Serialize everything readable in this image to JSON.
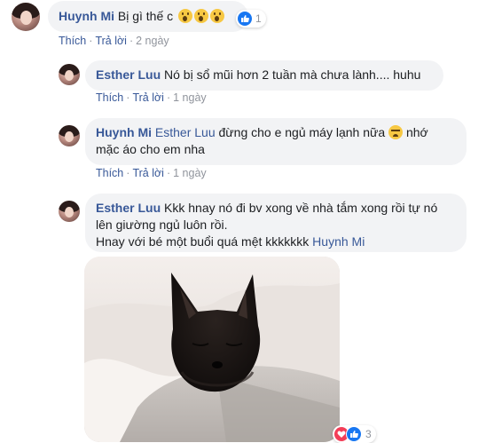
{
  "comment1": {
    "author": "Huynh Mi",
    "text": "Bị gì thế c",
    "reaction_count": "1",
    "like_label": "Thích",
    "reply_label": "Trả lời",
    "time": "2 ngày",
    "separator": "·"
  },
  "replies": [
    {
      "author": "Esther Luu",
      "text": "Nó bị sổ mũi hơn 2 tuần mà chưa lành.... huhu",
      "like_label": "Thích",
      "reply_label": "Trả lời",
      "time": "1 ngày",
      "separator": "·"
    },
    {
      "author": "Huynh Mi",
      "mention": "Esther Luu",
      "text_line1": "đừng cho e ngủ máy lạnh nữa",
      "text_line1_suffix": "nhớ",
      "text_line2": "mặc áo cho em nha",
      "like_label": "Thích",
      "reply_label": "Trả lời",
      "time": "1 ngày",
      "separator": "·"
    },
    {
      "author": "Esther Luu",
      "text_line1": "Kkk hnay nó đi bv xong về nhà tắm xong rồi tự nó",
      "text_line2": "lên giường ngủ luôn rồi.",
      "text_line3": "Hnay với bé một buổi quá mệt kkkkkkk",
      "mention": "Huynh Mi",
      "reaction_count": "3"
    }
  ],
  "icons": {
    "wow": "wow-reaction-icon",
    "like": "like-reaction-icon",
    "love": "love-reaction-icon",
    "cry": "crying-emoji-icon"
  },
  "colors": {
    "link": "#385898",
    "bubble": "#f2f3f5",
    "muted": "#90949c",
    "like_blue": "#1877f2",
    "love_red": "#f33e58"
  }
}
